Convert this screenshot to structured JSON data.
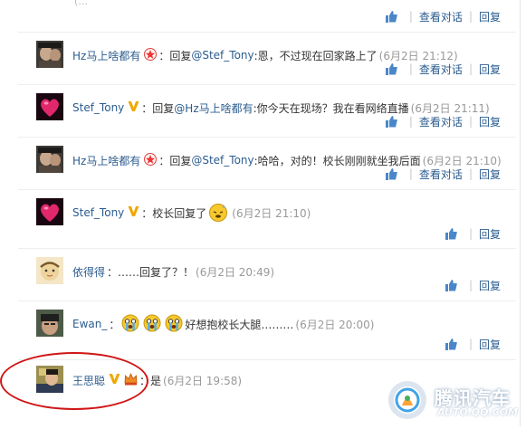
{
  "actions": {
    "like_icon": "thumbs-up-icon",
    "view_label": "查看对话",
    "reply_label": "回复"
  },
  "comments": [
    {
      "user": "Hz马上啥都有",
      "text_parts": [
        {
          "t": "：回复",
          "mention": false
        },
        {
          "t": "@Stef_Tony",
          "mention": true
        },
        {
          "t": ":恩，不过现在回家路上了",
          "mention": false
        }
      ],
      "time": "(6月2日 21:12)"
    },
    {
      "user": "Stef_Tony",
      "text_parts": [
        {
          "t": "：回复",
          "mention": false
        },
        {
          "t": "@Hz马上啥都有",
          "mention": true
        },
        {
          "t": ":你今天在现场？我在看网络直播",
          "mention": false
        }
      ],
      "time": "(6月2日 21:11)"
    },
    {
      "user": "Hz马上啥都有",
      "text_parts": [
        {
          "t": "：回复",
          "mention": false
        },
        {
          "t": "@Stef_Tony",
          "mention": true
        },
        {
          "t": ":哈哈，对的！校长刚刚就坐我后面",
          "mention": false
        }
      ],
      "time": "(6月2日 21:10)"
    },
    {
      "user": "Stef_Tony",
      "text_parts": [
        {
          "t": "：校长回复了",
          "mention": false
        }
      ],
      "time": "(6月2日 21:10)"
    },
    {
      "user": "依得得",
      "text_parts": [
        {
          "t": "：……回复了？！",
          "mention": false
        }
      ],
      "time": "(6月2日 20:49)"
    },
    {
      "user": "Ewan_",
      "text_parts": [
        {
          "t": "：",
          "mention": false
        },
        {
          "t": "好想抱校长大腿………",
          "mention": false
        }
      ],
      "time": "(6月2日 20:00)"
    },
    {
      "user": "王思聪",
      "text_parts": [
        {
          "t": "：是",
          "mention": false
        }
      ],
      "time": "(6月2日 19:58)"
    }
  ],
  "watermark": {
    "brand": "腾讯汽车",
    "url": "AUTO.QQ.COM"
  },
  "colors": {
    "link": "#2b5c8f",
    "time": "#999999",
    "highlight_circle": "#d01616",
    "vip_badge": "#f0a800"
  }
}
